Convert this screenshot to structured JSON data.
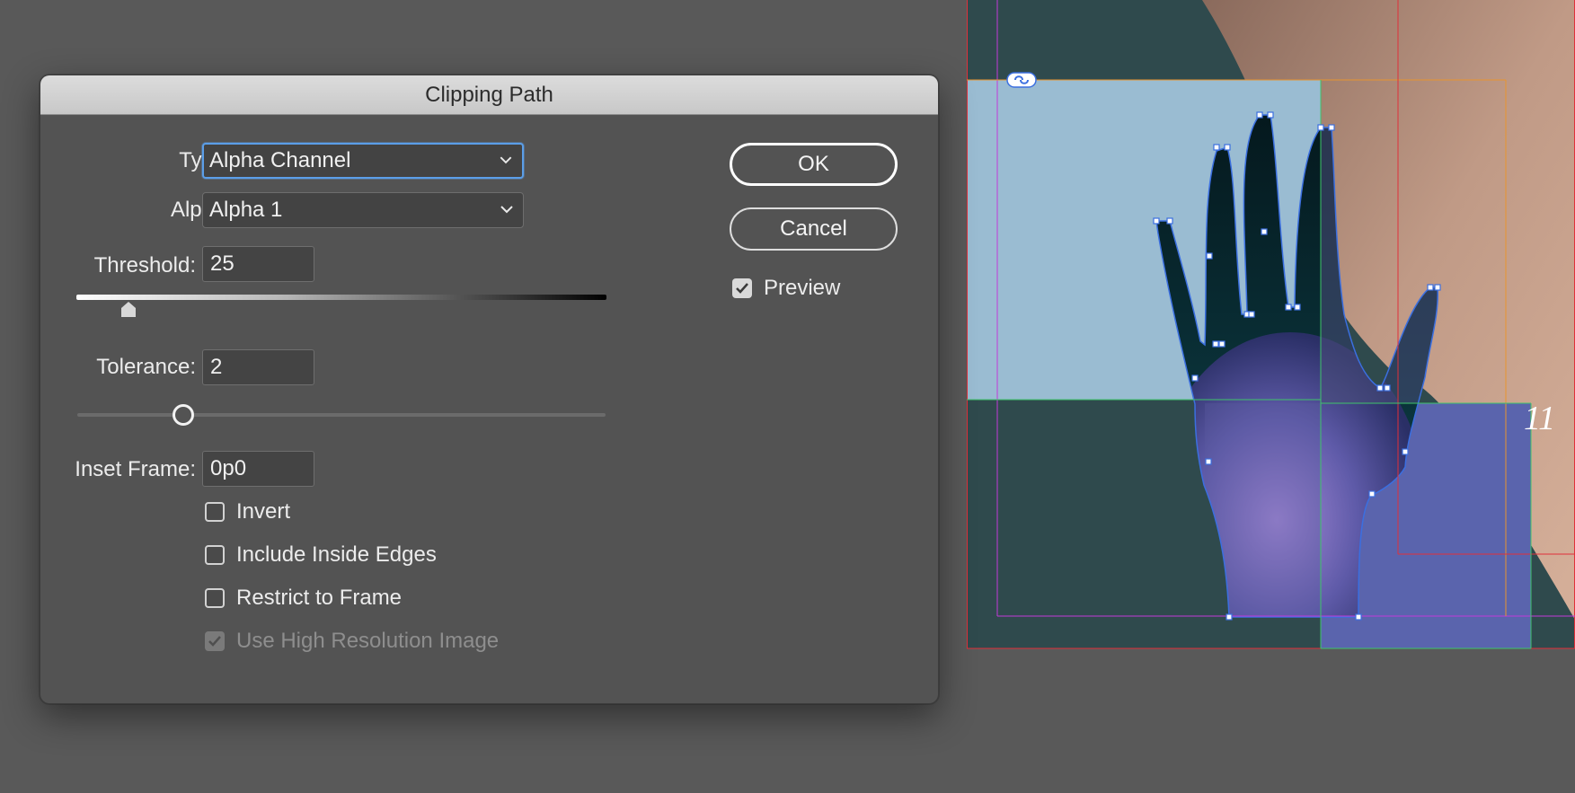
{
  "dialog": {
    "title": "Clipping Path",
    "type_label": "Type:",
    "type_value": "Alpha Channel",
    "alpha_label": "Alpha:",
    "alpha_value": "Alpha 1",
    "threshold_label": "Threshold:",
    "threshold_value": "25",
    "threshold_level": 25,
    "tolerance_label": "Tolerance:",
    "tolerance_value": "2",
    "tolerance_level": 2,
    "inset_label": "Inset Frame:",
    "inset_value": "0p0",
    "checkboxes": [
      {
        "label": "Invert",
        "checked": false,
        "enabled": true
      },
      {
        "label": "Include Inside Edges",
        "checked": false,
        "enabled": true
      },
      {
        "label": "Restrict to Frame",
        "checked": false,
        "enabled": true
      },
      {
        "label": "Use High Resolution Image",
        "checked": true,
        "enabled": false
      }
    ],
    "ok_label": "OK",
    "cancel_label": "Cancel",
    "preview_label": "Preview",
    "preview_checked": true
  },
  "canvas": {
    "page_number": "11",
    "colors": {
      "background_photo": "#2f4a4d",
      "skin": "#b89480",
      "frame_fill_light": "#9abcd2",
      "frame_fill_blue": "#5a64ad",
      "selection_path": "#3b6fe0",
      "margin_guide": "#c33ad9",
      "bleed_guide": "#e0303a",
      "column_guide": "#e8942e",
      "frame_edge_green": "#3fc46a"
    }
  },
  "colors": {
    "dialog_bg": "#535353",
    "app_bg": "#595959",
    "focus_ring": "#5b9ee8"
  }
}
